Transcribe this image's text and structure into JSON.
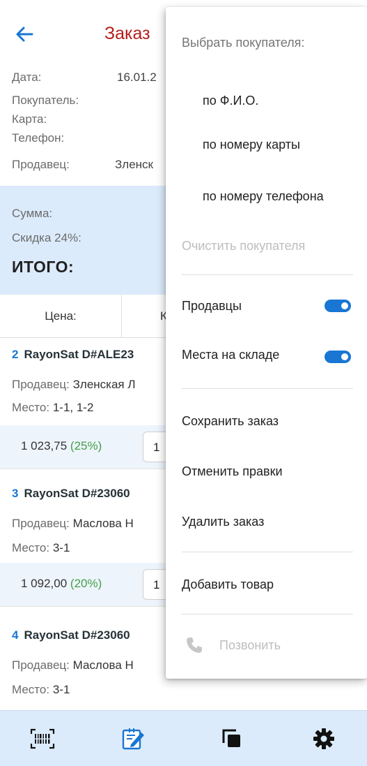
{
  "appbar": {
    "title": "Заказ"
  },
  "info": {
    "date_label": "Дата:",
    "date_value": "16.01.2",
    "buyer_label": "Покупатель:",
    "card_label": "Карта:",
    "phone_label": "Телефон:",
    "seller_label": "Продавец:",
    "seller_value": "Зленск"
  },
  "summary": {
    "sum_label": "Сумма:",
    "discount_label": "Скидка 24%:",
    "total_label": "ИТОГО:"
  },
  "columns": {
    "price": "Цена:",
    "qty": "К"
  },
  "items": [
    {
      "num": "2",
      "name": "RayonSat D#ALE23",
      "seller_label": "Продавец:",
      "seller": "Зленская Л",
      "place_label": "Место:",
      "place": "1-1, 1-2",
      "price": "1 023,75",
      "pct": "(25%)",
      "qty": "1"
    },
    {
      "num": "3",
      "name": "RayonSat D#23060",
      "seller_label": "Продавец:",
      "seller": "Маслова Н",
      "place_label": "Место:",
      "place": "3-1",
      "price": "1 092,00",
      "pct": "(20%)",
      "qty": "1"
    },
    {
      "num": "4",
      "name": "RayonSat D#23060",
      "seller_label": "Продавец:",
      "seller": "Маслова Н",
      "place_label": "Место:",
      "place": "3-1"
    }
  ],
  "menu": {
    "select_buyer_header": "Выбрать покупателя:",
    "by_name": "по Ф.И.О.",
    "by_card": "по номеру карты",
    "by_phone": "по номеру телефона",
    "clear_buyer": "Очистить покупателя",
    "sellers_toggle_label": "Продавцы",
    "sellers_toggle_on": true,
    "warehouse_toggle_label": "Места на складе",
    "warehouse_toggle_on": true,
    "save_order": "Сохранить заказ",
    "cancel_edits": "Отменить правки",
    "delete_order": "Удалить заказ",
    "add_product": "Добавить товар",
    "call": "Позвонить"
  },
  "bottom_nav": {
    "icons": [
      "barcode-scanner-icon",
      "edit-document-icon",
      "copy-icon",
      "settings-gear-icon"
    ]
  },
  "colors": {
    "accent": "#1976d2",
    "title_red": "#b71c1c",
    "summary_bg": "#dcebfb",
    "discount_green": "#43a047"
  }
}
